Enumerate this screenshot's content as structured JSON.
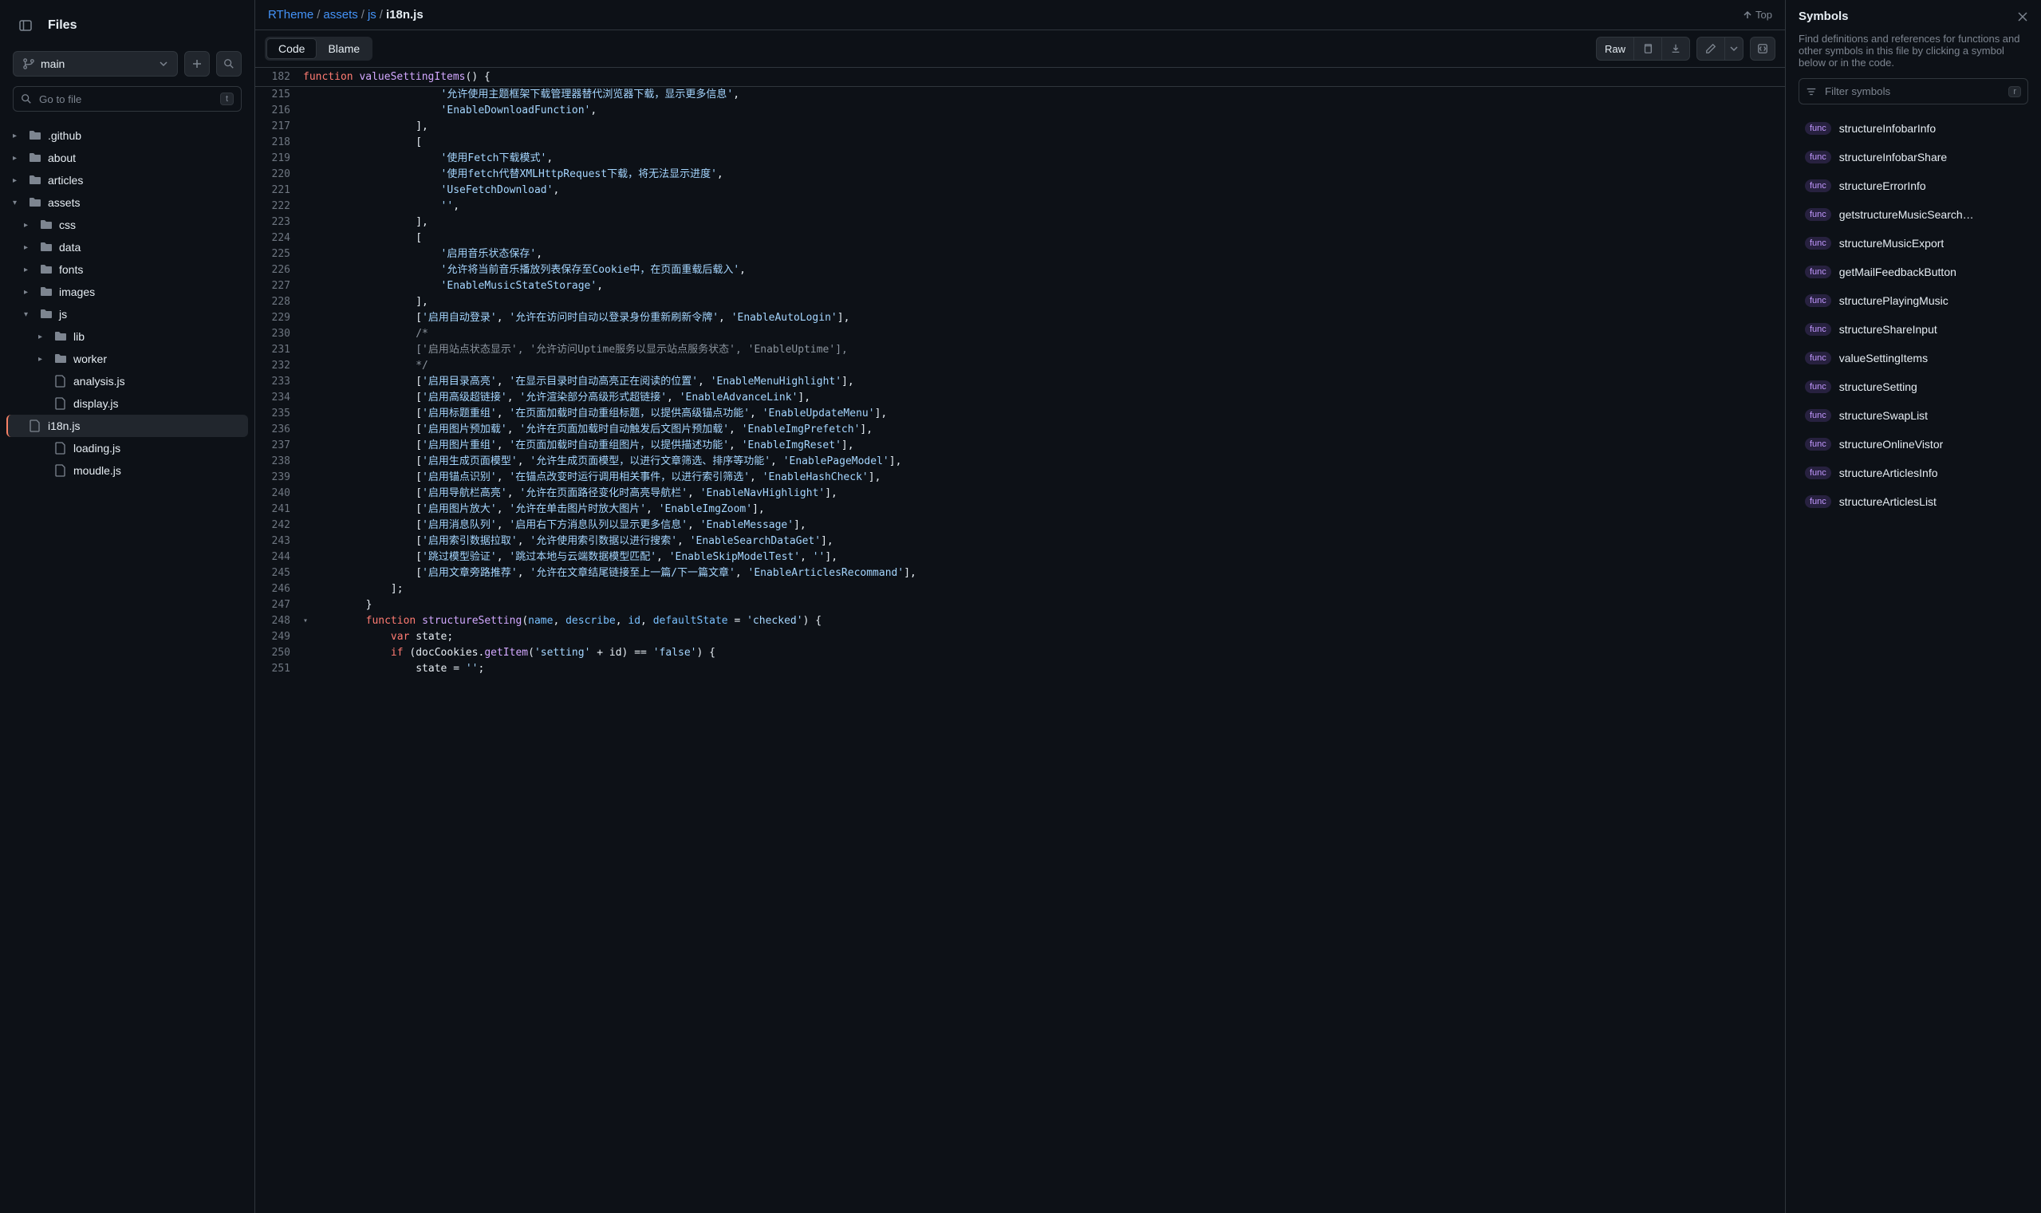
{
  "sidebar": {
    "title": "Files",
    "branch": "main",
    "search_placeholder": "Go to file",
    "search_kbd": "t",
    "tree": [
      {
        "name": ".github",
        "type": "folder",
        "indent": 0,
        "expanded": false
      },
      {
        "name": "about",
        "type": "folder",
        "indent": 0,
        "expanded": false
      },
      {
        "name": "articles",
        "type": "folder",
        "indent": 0,
        "expanded": false
      },
      {
        "name": "assets",
        "type": "folder",
        "indent": 0,
        "expanded": true
      },
      {
        "name": "css",
        "type": "folder",
        "indent": 1,
        "expanded": false
      },
      {
        "name": "data",
        "type": "folder",
        "indent": 1,
        "expanded": false
      },
      {
        "name": "fonts",
        "type": "folder",
        "indent": 1,
        "expanded": false
      },
      {
        "name": "images",
        "type": "folder",
        "indent": 1,
        "expanded": false
      },
      {
        "name": "js",
        "type": "folder",
        "indent": 1,
        "expanded": true
      },
      {
        "name": "lib",
        "type": "folder",
        "indent": 2,
        "expanded": false
      },
      {
        "name": "worker",
        "type": "folder",
        "indent": 2,
        "expanded": false
      },
      {
        "name": "analysis.js",
        "type": "file",
        "indent": 2
      },
      {
        "name": "display.js",
        "type": "file",
        "indent": 2
      },
      {
        "name": "i18n.js",
        "type": "file",
        "indent": 2,
        "active": true
      },
      {
        "name": "loading.js",
        "type": "file",
        "indent": 2
      },
      {
        "name": "moudle.js",
        "type": "file",
        "indent": 2
      }
    ]
  },
  "breadcrumb": {
    "root": "RTheme",
    "parts": [
      "assets",
      "js"
    ],
    "current": "i18n.js",
    "top_label": "Top"
  },
  "toolbar": {
    "tab_code": "Code",
    "tab_blame": "Blame",
    "raw": "Raw"
  },
  "sticky": {
    "line": "182",
    "code_html": "        <span class='tok-k'>function</span> <span class='tok-f'>valueSettingItems</span><span class='tok-p'>() {</span>"
  },
  "code_lines": [
    {
      "n": 215,
      "html": "                    <span class='tok-s'>'允许使用主题框架下载管理器替代浏览器下载，显示更多信息'</span><span class='tok-p'>,</span>"
    },
    {
      "n": 216,
      "html": "                    <span class='tok-s'>'EnableDownloadFunction'</span><span class='tok-p'>,</span>"
    },
    {
      "n": 217,
      "html": "                <span class='tok-p'>],</span>"
    },
    {
      "n": 218,
      "html": "                <span class='tok-p'>[</span>"
    },
    {
      "n": 219,
      "html": "                    <span class='tok-s'>'使用Fetch下载模式'</span><span class='tok-p'>,</span>"
    },
    {
      "n": 220,
      "html": "                    <span class='tok-s'>'使用fetch代替XMLHttpRequest下载，将无法显示进度'</span><span class='tok-p'>,</span>"
    },
    {
      "n": 221,
      "html": "                    <span class='tok-s'>'UseFetchDownload'</span><span class='tok-p'>,</span>"
    },
    {
      "n": 222,
      "html": "                    <span class='tok-s'>''</span><span class='tok-p'>,</span>"
    },
    {
      "n": 223,
      "html": "                <span class='tok-p'>],</span>"
    },
    {
      "n": 224,
      "html": "                <span class='tok-p'>[</span>"
    },
    {
      "n": 225,
      "html": "                    <span class='tok-s'>'启用音乐状态保存'</span><span class='tok-p'>,</span>"
    },
    {
      "n": 226,
      "html": "                    <span class='tok-s'>'允许将当前音乐播放列表保存至Cookie中，在页面重载后载入'</span><span class='tok-p'>,</span>"
    },
    {
      "n": 227,
      "html": "                    <span class='tok-s'>'EnableMusicStateStorage'</span><span class='tok-p'>,</span>"
    },
    {
      "n": 228,
      "html": "                <span class='tok-p'>],</span>"
    },
    {
      "n": 229,
      "html": "                <span class='tok-p'>[</span><span class='tok-s'>'启用自动登录'</span><span class='tok-p'>, </span><span class='tok-s'>'允许在访问时自动以登录身份重新刷新令牌'</span><span class='tok-p'>, </span><span class='tok-s'>'EnableAutoLogin'</span><span class='tok-p'>],</span>"
    },
    {
      "n": 230,
      "html": "                <span class='tok-c'>/*</span>"
    },
    {
      "n": 231,
      "html": "<span class='tok-c'>                ['启用站点状态显示', '允许访问Uptime服务以显示站点服务状态', 'EnableUptime'],</span>"
    },
    {
      "n": 232,
      "html": "<span class='tok-c'>                */</span>"
    },
    {
      "n": 233,
      "html": "                <span class='tok-p'>[</span><span class='tok-s'>'启用目录高亮'</span><span class='tok-p'>, </span><span class='tok-s'>'在显示目录时自动高亮正在阅读的位置'</span><span class='tok-p'>, </span><span class='tok-s'>'EnableMenuHighlight'</span><span class='tok-p'>],</span>"
    },
    {
      "n": 234,
      "html": "                <span class='tok-p'>[</span><span class='tok-s'>'启用高级超链接'</span><span class='tok-p'>, </span><span class='tok-s'>'允许渲染部分高级形式超链接'</span><span class='tok-p'>, </span><span class='tok-s'>'EnableAdvanceLink'</span><span class='tok-p'>],</span>"
    },
    {
      "n": 235,
      "html": "                <span class='tok-p'>[</span><span class='tok-s'>'启用标题重组'</span><span class='tok-p'>, </span><span class='tok-s'>'在页面加载时自动重组标题，以提供高级锚点功能'</span><span class='tok-p'>, </span><span class='tok-s'>'EnableUpdateMenu'</span><span class='tok-p'>],</span>"
    },
    {
      "n": 236,
      "html": "                <span class='tok-p'>[</span><span class='tok-s'>'启用图片预加载'</span><span class='tok-p'>, </span><span class='tok-s'>'允许在页面加载时自动触发后文图片预加载'</span><span class='tok-p'>, </span><span class='tok-s'>'EnableImgPrefetch'</span><span class='tok-p'>],</span>"
    },
    {
      "n": 237,
      "html": "                <span class='tok-p'>[</span><span class='tok-s'>'启用图片重组'</span><span class='tok-p'>, </span><span class='tok-s'>'在页面加载时自动重组图片，以提供描述功能'</span><span class='tok-p'>, </span><span class='tok-s'>'EnableImgReset'</span><span class='tok-p'>],</span>"
    },
    {
      "n": 238,
      "html": "                <span class='tok-p'>[</span><span class='tok-s'>'启用生成页面模型'</span><span class='tok-p'>, </span><span class='tok-s'>'允许生成页面模型，以进行文章筛选、排序等功能'</span><span class='tok-p'>, </span><span class='tok-s'>'EnablePageModel'</span><span class='tok-p'>],</span>"
    },
    {
      "n": 239,
      "html": "                <span class='tok-p'>[</span><span class='tok-s'>'启用锚点识别'</span><span class='tok-p'>, </span><span class='tok-s'>'在锚点改变时运行调用相关事件，以进行索引筛选'</span><span class='tok-p'>, </span><span class='tok-s'>'EnableHashCheck'</span><span class='tok-p'>],</span>"
    },
    {
      "n": 240,
      "html": "                <span class='tok-p'>[</span><span class='tok-s'>'启用导航栏高亮'</span><span class='tok-p'>, </span><span class='tok-s'>'允许在页面路径变化时高亮导航栏'</span><span class='tok-p'>, </span><span class='tok-s'>'EnableNavHighlight'</span><span class='tok-p'>],</span>"
    },
    {
      "n": 241,
      "html": "                <span class='tok-p'>[</span><span class='tok-s'>'启用图片放大'</span><span class='tok-p'>, </span><span class='tok-s'>'允许在单击图片时放大图片'</span><span class='tok-p'>, </span><span class='tok-s'>'EnableImgZoom'</span><span class='tok-p'>],</span>"
    },
    {
      "n": 242,
      "html": "                <span class='tok-p'>[</span><span class='tok-s'>'启用消息队列'</span><span class='tok-p'>, </span><span class='tok-s'>'启用右下方消息队列以显示更多信息'</span><span class='tok-p'>, </span><span class='tok-s'>'EnableMessage'</span><span class='tok-p'>],</span>"
    },
    {
      "n": 243,
      "html": "                <span class='tok-p'>[</span><span class='tok-s'>'启用索引数据拉取'</span><span class='tok-p'>, </span><span class='tok-s'>'允许使用索引数据以进行搜索'</span><span class='tok-p'>, </span><span class='tok-s'>'EnableSearchDataGet'</span><span class='tok-p'>],</span>"
    },
    {
      "n": 244,
      "html": "                <span class='tok-p'>[</span><span class='tok-s'>'跳过模型验证'</span><span class='tok-p'>, </span><span class='tok-s'>'跳过本地与云端数据模型匹配'</span><span class='tok-p'>, </span><span class='tok-s'>'EnableSkipModelTest'</span><span class='tok-p'>, </span><span class='tok-s'>''</span><span class='tok-p'>],</span>"
    },
    {
      "n": 245,
      "html": "                <span class='tok-p'>[</span><span class='tok-s'>'启用文章旁路推荐'</span><span class='tok-p'>, </span><span class='tok-s'>'允许在文章结尾链接至上一篇/下一篇文章'</span><span class='tok-p'>, </span><span class='tok-s'>'EnableArticlesRecommand'</span><span class='tok-p'>],</span>"
    },
    {
      "n": 246,
      "html": "            <span class='tok-p'>];</span>"
    },
    {
      "n": 247,
      "html": "        <span class='tok-p'>}</span>"
    },
    {
      "n": 248,
      "html": "        <span class='tok-k'>function</span> <span class='tok-f'>structureSetting</span><span class='tok-p'>(</span><span class='tok-v'>name</span><span class='tok-p'>, </span><span class='tok-v'>describe</span><span class='tok-p'>, </span><span class='tok-v'>id</span><span class='tok-p'>, </span><span class='tok-v'>defaultState</span><span class='tok-p'> = </span><span class='tok-s'>'checked'</span><span class='tok-p'>) {</span>",
      "fold": true
    },
    {
      "n": 249,
      "html": "            <span class='tok-k'>var</span> <span class='tok-p'>state;</span>"
    },
    {
      "n": 250,
      "html": "            <span class='tok-k'>if</span> <span class='tok-p'>(docCookies.</span><span class='tok-f'>getItem</span><span class='tok-p'>(</span><span class='tok-s'>'setting'</span><span class='tok-p'> + id) == </span><span class='tok-s'>'false'</span><span class='tok-p'>) {</span>"
    },
    {
      "n": 251,
      "html": "                <span class='tok-p'>state = </span><span class='tok-s'>''</span><span class='tok-p'>;</span>"
    }
  ],
  "symbols": {
    "title": "Symbols",
    "desc": "Find definitions and references for functions and other symbols in this file by clicking a symbol below or in the code.",
    "filter_placeholder": "Filter symbols",
    "filter_kbd": "r",
    "badge": "func",
    "items": [
      "structureInfobarInfo",
      "structureInfobarShare",
      "structureErrorInfo",
      "getstructureMusicSearch…",
      "structureMusicExport",
      "getMailFeedbackButton",
      "structurePlayingMusic",
      "structureShareInput",
      "valueSettingItems",
      "structureSetting",
      "structureSwapList",
      "structureOnlineVistor",
      "structureArticlesInfo",
      "structureArticlesList"
    ]
  }
}
